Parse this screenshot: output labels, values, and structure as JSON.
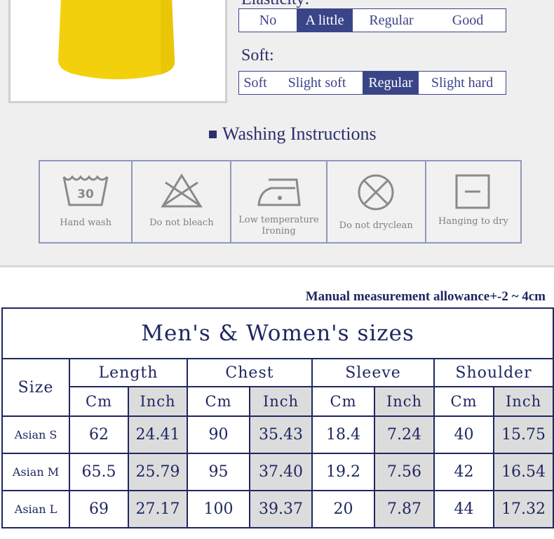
{
  "attributes": {
    "elasticity": {
      "label": "Elasticity:",
      "options": [
        "No",
        "A little",
        "Regular",
        "Good"
      ],
      "selected": "A little"
    },
    "soft": {
      "label": "Soft:",
      "options": [
        "Soft",
        "Slight soft",
        "Regular",
        "Slight hard"
      ],
      "selected": "Regular"
    }
  },
  "washing": {
    "title": "Washing Instructions",
    "items": [
      {
        "caption": "Hand wash",
        "icon": "hand-wash-icon",
        "badge": "30"
      },
      {
        "caption": "Do not bleach",
        "icon": "no-bleach-icon"
      },
      {
        "caption": "Low temperature Ironing",
        "caption_lines": [
          "Low temperature",
          "Ironing"
        ],
        "icon": "low-iron-icon"
      },
      {
        "caption": "Do not dryclean",
        "icon": "no-dryclean-icon"
      },
      {
        "caption": "Hanging to dry",
        "icon": "hang-dry-icon"
      }
    ]
  },
  "sizes": {
    "allowance_note": "Manual measurement allowance+-2 ~ 4cm",
    "title": "Men's & Women's sizes",
    "size_header": "Size",
    "groups": [
      "Length",
      "Chest",
      "Sleeve",
      "Shoulder"
    ],
    "unit_cm": "Cm",
    "unit_inch": "Inch",
    "rows": [
      {
        "size": "Asian S",
        "values": [
          "62",
          "24.41",
          "90",
          "35.43",
          "18.4",
          "7.24",
          "40",
          "15.75"
        ]
      },
      {
        "size": "Asian M",
        "values": [
          "65.5",
          "25.79",
          "95",
          "37.40",
          "19.2",
          "7.56",
          "42",
          "16.54"
        ]
      },
      {
        "size": "Asian L",
        "values": [
          "69",
          "27.17",
          "100",
          "39.37",
          "20",
          "7.87",
          "44",
          "17.32"
        ]
      }
    ]
  },
  "colors": {
    "accent": "#3a4589",
    "text": "#1f2760",
    "shirt": "#f2d10c",
    "inch_cell": "#dcdcdc"
  }
}
